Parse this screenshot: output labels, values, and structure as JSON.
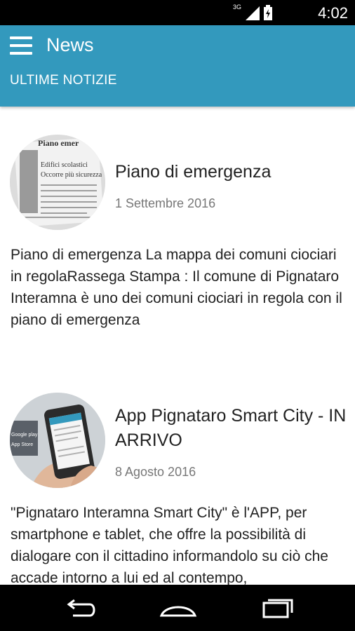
{
  "status_bar": {
    "network": "3G",
    "time": "4:02"
  },
  "app_bar": {
    "title": "News",
    "subtitle": "ULTIME NOTIZIE"
  },
  "news": [
    {
      "title": "Piano di emergenza",
      "date": "1 Settembre 2016",
      "description": "Piano di emergenza La mappa dei comuni ciociari in regolaRassega Stampa : Il comune di Pignataro Interamna è uno dei comuni ciociari in regola con il piano di emergenza",
      "thumb_text": [
        "Piano emer",
        "Edifici scolastici",
        "Occorre più sicurezza"
      ]
    },
    {
      "title": "App Pignataro Smart City - IN ARRIVO",
      "date": "8 Agosto 2016",
      "description": "\"Pignataro Interamna Smart City\" è l'APP, per smartphone e tablet, che offre la possibilità di dialogare con il cittadino informandolo su ciò che accade intorno a lui ed al contempo,",
      "thumb_text": [
        "Google play",
        "App Store"
      ]
    }
  ],
  "colors": {
    "app_bar": "#3399bd",
    "status_bar": "#000000",
    "nav_bar": "#000000"
  }
}
